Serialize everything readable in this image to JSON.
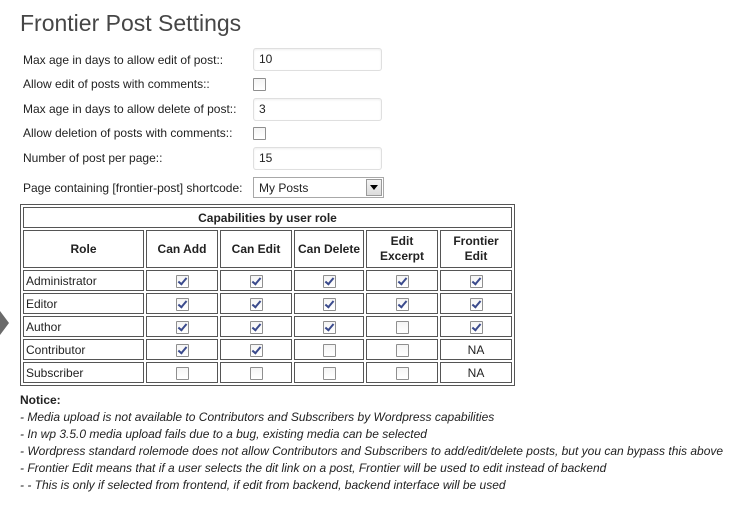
{
  "page": {
    "title": "Frontier Post Settings"
  },
  "settings": {
    "max_age_edit": {
      "label": "Max age in days to allow edit of post::",
      "value": "10"
    },
    "allow_edit_comments": {
      "label": "Allow edit of posts with comments::",
      "checked": false
    },
    "max_age_delete": {
      "label": "Max age in days to allow delete of post::",
      "value": "3"
    },
    "allow_delete_comments": {
      "label": "Allow deletion of posts with comments::",
      "checked": false
    },
    "posts_per_page": {
      "label": "Number of post per page::",
      "value": "15"
    },
    "shortcode_page": {
      "label": "Page containing [frontier-post] shortcode:",
      "selected": "My Posts"
    }
  },
  "capabilities": {
    "caption": "Capabilities by user role",
    "headers": [
      "Role",
      "Can Add",
      "Can Edit",
      "Can Delete",
      "Edit Excerpt",
      "Frontier Edit"
    ],
    "rows": [
      {
        "role": "Administrator",
        "add": true,
        "edit": true,
        "delete": true,
        "excerpt": true,
        "frontier": "checked"
      },
      {
        "role": "Editor",
        "add": true,
        "edit": true,
        "delete": true,
        "excerpt": true,
        "frontier": "checked"
      },
      {
        "role": "Author",
        "add": true,
        "edit": true,
        "delete": true,
        "excerpt": false,
        "frontier": "checked"
      },
      {
        "role": "Contributor",
        "add": true,
        "edit": true,
        "delete": false,
        "excerpt": false,
        "frontier": "NA"
      },
      {
        "role": "Subscriber",
        "add": false,
        "edit": false,
        "delete": false,
        "excerpt": false,
        "frontier": "NA"
      }
    ]
  },
  "notice": {
    "title": "Notice:",
    "lines": [
      "- Media upload is not available to Contributors and Subscribers by Wordpress capabilities",
      "- In wp 3.5.0 media upload fails due to a bug, existing media can be selected",
      "- Wordpress standard rolemode does not allow Contributors and Subscribers to add/edit/delete posts, but you can bypass this above",
      "- Frontier Edit means that if a user selects the dit link on a post, Frontier will be used to edit instead of backend",
      "- - This is only if selected from frontend, if edit from backend, backend interface will be used"
    ]
  }
}
